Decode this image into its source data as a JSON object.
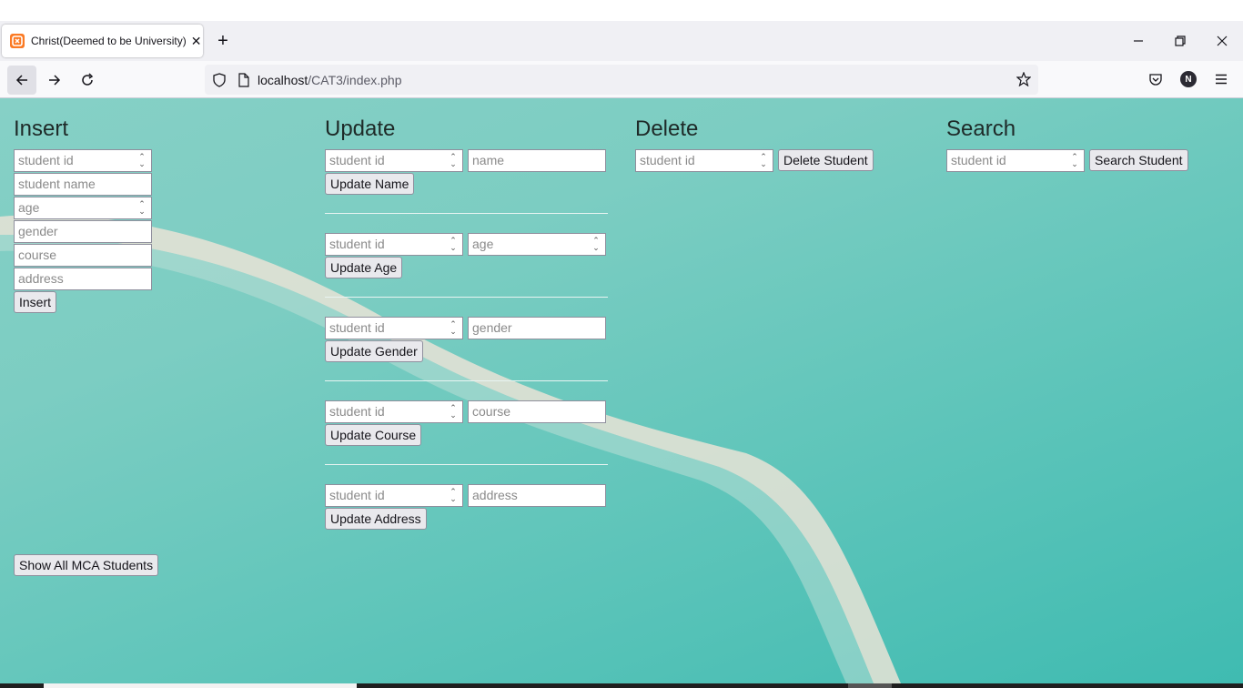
{
  "browser": {
    "tab_title": "Christ(Deemed to be University)",
    "favicon_text": "x",
    "url_host": "localhost",
    "url_path": "/CAT3/index.php"
  },
  "icons": {
    "back": "arrow-left-icon",
    "forward": "arrow-right-icon",
    "reload": "reload-icon",
    "shield": "shield-icon",
    "page": "page-icon",
    "star": "star-icon",
    "pocket": "pocket-icon",
    "account": "account-icon",
    "menu": "menu-icon"
  },
  "account_initial": "N",
  "insert": {
    "heading": "Insert",
    "id_placeholder": "student id",
    "name_placeholder": "student name",
    "age_placeholder": "age",
    "gender_placeholder": "gender",
    "course_placeholder": "course",
    "address_placeholder": "address",
    "button": "Insert"
  },
  "update": {
    "heading": "Update",
    "name": {
      "id_placeholder": "student id",
      "value_placeholder": "name",
      "button": "Update Name"
    },
    "age": {
      "id_placeholder": "student id",
      "value_placeholder": "age",
      "button": "Update Age"
    },
    "gender": {
      "id_placeholder": "student id",
      "value_placeholder": "gender",
      "button": "Update Gender"
    },
    "course": {
      "id_placeholder": "student id",
      "value_placeholder": "course",
      "button": "Update Course"
    },
    "address": {
      "id_placeholder": "student id",
      "value_placeholder": "address",
      "button": "Update Address"
    }
  },
  "delete": {
    "heading": "Delete",
    "id_placeholder": "student id",
    "button": "Delete Student"
  },
  "search": {
    "heading": "Search",
    "id_placeholder": "student id",
    "button": "Search Student"
  },
  "show_all_button": "Show All MCA Students",
  "colors": {
    "bg_light": "#86d0c6",
    "bg_dark": "#3fbbb1",
    "sand": "#e9e3d6",
    "favicon": "#fb7a24"
  }
}
